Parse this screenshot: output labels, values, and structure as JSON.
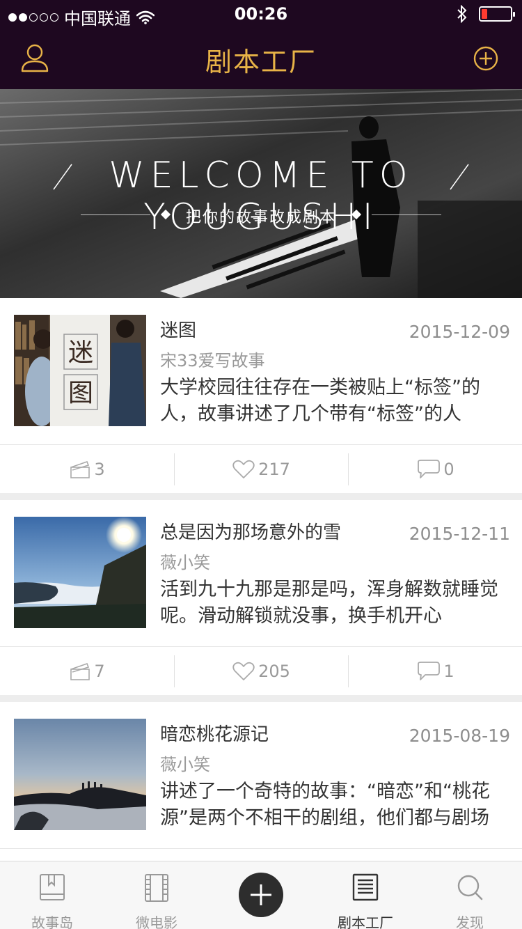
{
  "status_bar": {
    "carrier": "中国联通",
    "time": "00:26"
  },
  "nav": {
    "title": "剧本工厂"
  },
  "banner": {
    "headline": "WELCOME TO YOUGUSHI",
    "subtitle": "把你的故事改成剧本"
  },
  "stories": [
    {
      "title": "迷图",
      "date": "2015-12-09",
      "author": "宋33爱写故事",
      "description": "大学校园往往存在一类被贴上“标签”的人，故事讲述了几个带有“标签”的人",
      "scripts": "3",
      "likes": "217",
      "comments": "0"
    },
    {
      "title": "总是因为那场意外的雪",
      "date": "2015-12-11",
      "author": "薇小笑",
      "description": "活到九十九那是那是吗，浑身解数就睡觉呢。滑动解锁就没事，换手机开心",
      "scripts": "7",
      "likes": "205",
      "comments": "1"
    },
    {
      "title": "暗恋桃花源记",
      "date": "2015-08-19",
      "author": "薇小笑",
      "description": "讲述了一个奇特的故事：“暗恋”和“桃花源”是两个不相干的剧组，他们都与剧场",
      "scripts": "",
      "likes": "",
      "comments": ""
    }
  ],
  "tabs": [
    {
      "label": "故事岛",
      "icon": "book-icon"
    },
    {
      "label": "微电影",
      "icon": "film-icon"
    },
    {
      "label": "",
      "icon": "plus-icon"
    },
    {
      "label": "剧本工厂",
      "icon": "document-icon"
    },
    {
      "label": "发现",
      "icon": "search-icon"
    }
  ],
  "colors": {
    "nav_bg": "#1e0820",
    "accent_gold": "#e8b347",
    "text_primary": "#333333",
    "text_muted": "#999999",
    "battery_low": "#ff3b30"
  },
  "battery_level": 0.2
}
